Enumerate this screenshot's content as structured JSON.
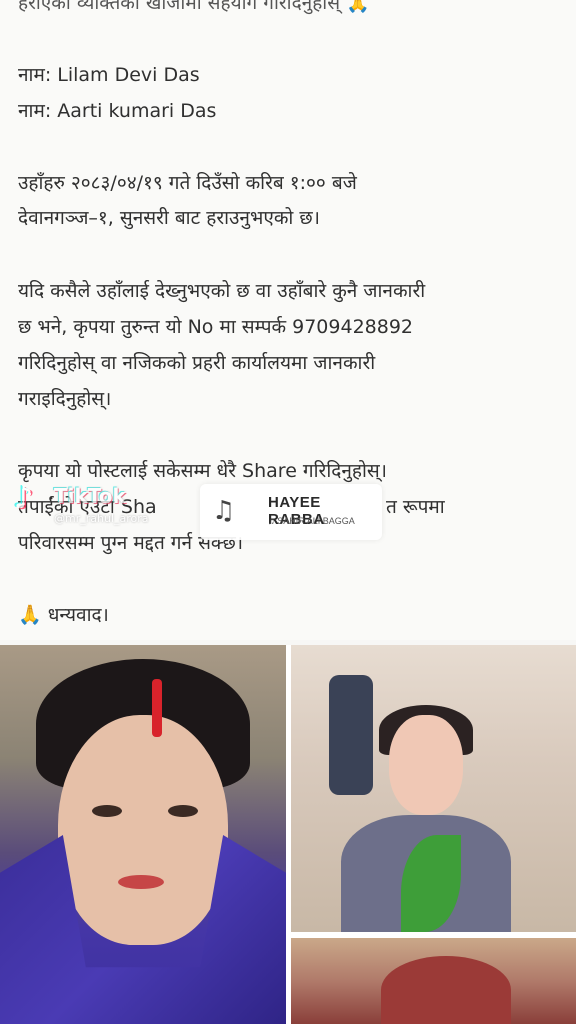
{
  "post": {
    "lines": [
      "हराएको व्यक्तिको खोजीमा सहयोग गरिदिनुहोस् 🙏",
      "नाम: Lilam Devi Das",
      "नाम: Aarti kumari Das",
      "उहाँहरु २०८३/०४/१९ गते दिउँसो करिब १:०० बजे",
      "देवानगञ्ज–१, सुनसरी बाट हराउनुभएको छ।",
      "यदि कसैले उहाँलाई देख्नुभएको छ वा उहाँबारे कुनै जानकारी",
      "छ भने, कृपया तुरुन्त यो No मा सम्पर्क 9709428892",
      "गरिदिनुहोस् वा नजिकको प्रहरी कार्यालयमा जानकारी",
      "गराइदिनुहोस्।",
      "कृपया यो पोस्टलाई सकेसम्म धेरै Share गरिदिनुहोस्।",
      "तपाईंको एउटा Sha",
      "त रूपमा",
      "परिवारसम्म पुग्न मद्दत गर्न सक्छ।",
      "🙏 धन्यवाद।"
    ]
  },
  "tiktok": {
    "logo_icon": "tiktok-logo-icon",
    "name": "TikTok",
    "handle": "@mr_rahul_arora"
  },
  "music": {
    "icon": "music-note-icon",
    "title": "HAYEE RABBA",
    "artist": "♫ SAHIR ALI BAGGA"
  }
}
